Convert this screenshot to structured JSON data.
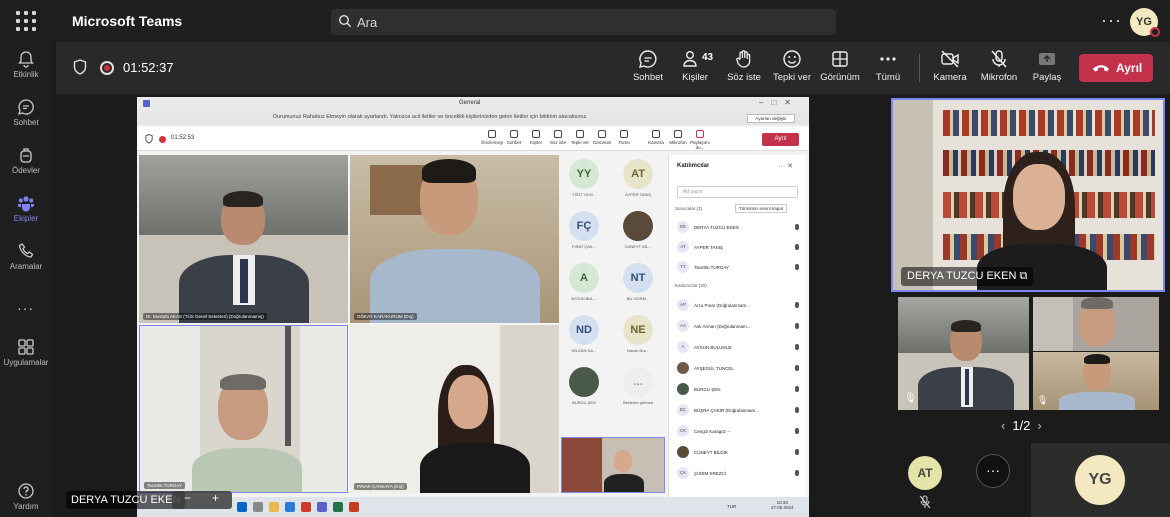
{
  "app": {
    "title": "Microsoft Teams"
  },
  "search": {
    "placeholder": "Ara"
  },
  "user": {
    "initials": "YG"
  },
  "rail": {
    "items": [
      {
        "label": "Etkinlik"
      },
      {
        "label": "Sohbet"
      },
      {
        "label": "Ödevler"
      },
      {
        "label": "Ekipler"
      },
      {
        "label": "Aramalar"
      },
      {
        "label": "Uygulamalar"
      },
      {
        "label": "Yardım"
      }
    ]
  },
  "meeting": {
    "timer": "01:52:37",
    "participant_count": "43",
    "buttons": {
      "chat": "Sohbet",
      "people": "Kişiler",
      "raise_hand": "Söz iste",
      "react": "Tepki ver",
      "view": "Görünüm",
      "more": "Tümü",
      "camera": "Kamera",
      "mic": "Mikrofon",
      "share": "Paylaş",
      "leave": "Ayrıl"
    }
  },
  "shared": {
    "window_title": "General",
    "banner": "Durumunuz Rahatsız Etmeyin olarak ayarlandı. Yalnızca acil iletiler ve öncelikli kişilerinizden gelen iletiler için bildirim alacaksınız.",
    "banner_button": "Ayarları değiştir",
    "timer": "01:52:53",
    "tools": [
      "Önizlemeyi",
      "Sohbet",
      "Kişiler",
      "Söz iste",
      "Tepki ver",
      "Görünüm",
      "Tümü",
      "Kamera",
      "Mikrofon",
      "Paylaşımı du..."
    ],
    "leave": "Ayrıl",
    "tiles": {
      "t1": "Dr. Mustafa AKAS (TÜS Genel Sekreteri) (Doğrulanmamış)",
      "t2": "GÖKAY KARAKURUM (Dış)",
      "t3": "Tacettin TURGAY",
      "t4": "PINAR ÇANKAYA (Dış)"
    },
    "grid": [
      {
        "initials": "YY",
        "name": "YİĞİT YILM..."
      },
      {
        "initials": "AT",
        "name": "AYPER TANIŞ"
      },
      {
        "initials": "FÇ",
        "name": "FIRAT ÇAK..."
      },
      {
        "initials": "",
        "name": "CÜNEYT BİL..."
      },
      {
        "initials": "A",
        "name": "AYSUN BUL..."
      },
      {
        "initials": "NT",
        "name": "BİL NORM..."
      },
      {
        "initials": "ND",
        "name": "NİLCAN DA..."
      },
      {
        "initials": "NE",
        "name": "Nazan Nur..."
      },
      {
        "initials": "",
        "name": "BURCU ŞEN"
      },
      {
        "initials": "...",
        "name": "Bekleme görmek"
      }
    ],
    "panel": {
      "title": "Katılımcılar",
      "search": "Ad yazın",
      "presenters_header": "Sunucular (3)",
      "mute_all": "Tümünün sesini kapat",
      "presenters": [
        {
          "initials": "DE",
          "name": "DERYA TUZCU EKEN"
        },
        {
          "initials": "AT",
          "name": "AYPER TANIŞ"
        },
        {
          "initials": "TT",
          "name": "Tacettin TURGAY"
        }
      ],
      "attendees_header": "Katılımcılar (40)",
      "attendees": [
        {
          "initials": "AP",
          "name": "Arzu Pınar (Doğrulanmam..."
        },
        {
          "initials": "AA",
          "name": "Aslı Arman (Doğrulanmam..."
        },
        {
          "initials": "A",
          "name": "AYSUN BULUNUZ"
        },
        {
          "initials": "",
          "name": "AYŞEGÜL TUNCEL"
        },
        {
          "initials": "",
          "name": "BURCU ŞEN"
        },
        {
          "initials": "BÇ",
          "name": "BÜŞRA ÇAKIR (Doğrulanmam..."
        },
        {
          "initials": "CK",
          "name": "Cengiz Karagöz --"
        },
        {
          "initials": "",
          "name": "CÜNEYT BİLDİK"
        },
        {
          "initials": "ÇK",
          "name": "ÇİSEM KREZCİ"
        }
      ]
    },
    "clock": {
      "time": "10:33",
      "date": "27.05.2024",
      "lang": "TUR"
    }
  },
  "right": {
    "speaker_name": "DERYA TUZCU EKEN",
    "pager": "1/2",
    "attendee_initials": "AT",
    "more": "···",
    "self_initials": "YG"
  },
  "bottom": {
    "name_tag": "DERYA TUZCU EKEN"
  },
  "colors": {
    "accent": "#7f85f5",
    "leave": "#c4314b"
  }
}
